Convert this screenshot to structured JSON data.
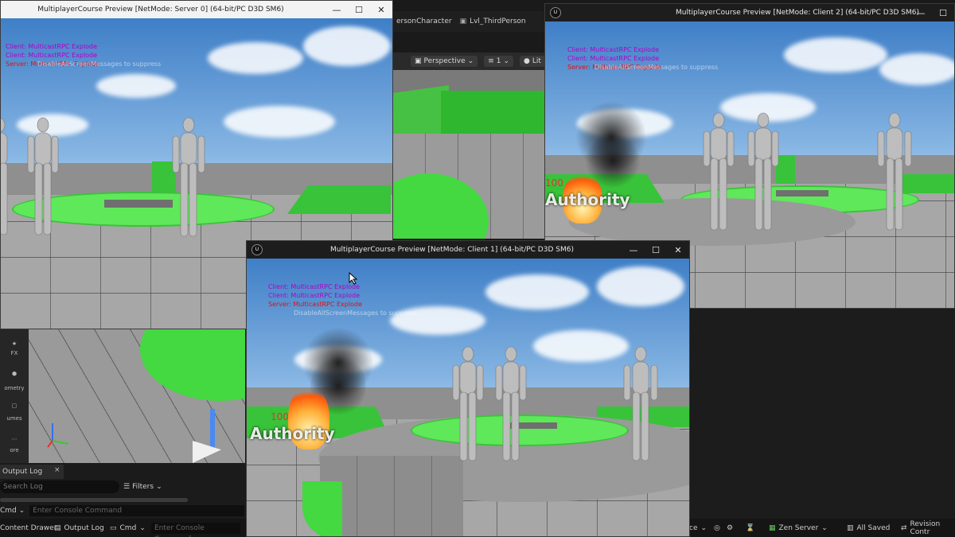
{
  "editor": {
    "tabs": [
      "ersonCharacter",
      "Lvl_ThirdPerson"
    ],
    "toolbar": {
      "perspective": "Perspective",
      "fov": "1",
      "lit": "Lit"
    },
    "side_icons": [
      "FX",
      "ometry",
      "umes",
      "ore"
    ],
    "output_log": {
      "tab_label": "Output Log",
      "close": "×",
      "search_placeholder": "Search Log",
      "filters_label": "Filters",
      "cmd_label": "Cmd",
      "console_placeholder": "Enter Console Command"
    },
    "status_bar": {
      "content_drawer": "Content Drawer",
      "output_log": "Output Log",
      "cmd": "Cmd",
      "console_placeholder": "Enter Console Command",
      "source_fragment": "ce",
      "zen_server": "Zen Server",
      "all_saved": "All Saved",
      "revision": "Revision Contr"
    }
  },
  "windows": {
    "server": {
      "title": "MultiplayerCourse Preview [NetMode: Server 0]  (64-bit/PC D3D SM6)",
      "messages": [
        "Client: MulticastRPC Explode",
        "Client: MulticastRPC Explode",
        "Server: MulticastRPC Explode"
      ],
      "dismiss": "DisableAllScreenMessages to suppress"
    },
    "client2": {
      "title": "MultiplayerCourse Preview [NetMode: Client 2]  (64-bit/PC D3D SM6)",
      "messages": [
        "Client: MulticastRPC Explode",
        "Client: MulticastRPC Explode",
        "Server: MulticastRPC Explode"
      ],
      "dismiss": "DisableAllScreenMessages to suppress",
      "hp": "100",
      "authority": "Authority"
    },
    "client1": {
      "title": "MultiplayerCourse Preview [NetMode: Client 1]  (64-bit/PC D3D SM6)",
      "messages": [
        "Client: MulticastRPC Explode",
        "Client: MulticastRPC Explode",
        "Server: MulticastRPC Explode"
      ],
      "dismiss": "DisableAllScreenMessages to suppress",
      "hp": "100",
      "authority": "Authority"
    }
  },
  "window_controls": {
    "minimize": "—",
    "maximize": "☐",
    "close": "✕"
  },
  "colors": {
    "client_msg": "#b000c8",
    "server_msg": "#e21010",
    "green": "#5fe85a"
  }
}
